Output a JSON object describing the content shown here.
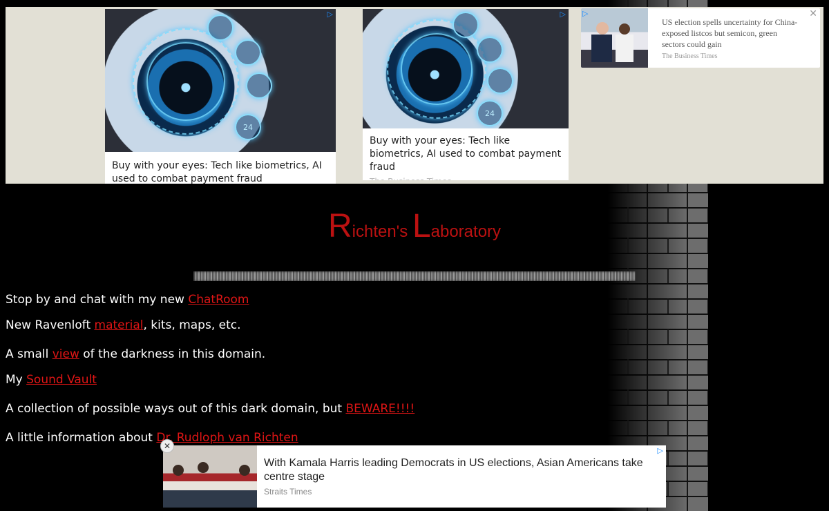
{
  "ads": {
    "card1": {
      "caption": "Buy with your eyes: Tech like biometrics, AI used to combat payment fraud"
    },
    "card2": {
      "caption": "Buy with your eyes: Tech like biometrics, AI used to combat payment fraud",
      "source": "The Business Times"
    },
    "card3": {
      "headline": "US election spells uncertainty for China-exposed listcos but semicon, green sectors could gain",
      "source": "The Business Times"
    },
    "bottom": {
      "headline": "With Kamala Harris leading Democrats in US elections, Asian Americans take centre stage",
      "source": "Straits Times",
      "close_label": "✕"
    },
    "eye_node_label": "24"
  },
  "page": {
    "title_first_initial": "R",
    "title_first_rest": "ichten's ",
    "title_second_initial": "L",
    "title_second_rest": "aboratory"
  },
  "links": [
    {
      "prefix": "Stop by and chat with my new ",
      "link": "ChatRoom",
      "suffix": ""
    },
    {
      "prefix": "New Ravenloft ",
      "link": "material",
      "suffix": ", kits, maps, etc."
    },
    {
      "prefix": "A small ",
      "link": "view",
      "suffix": " of the darkness in this domain."
    },
    {
      "prefix": "My ",
      "link": "Sound Vault",
      "suffix": ""
    },
    {
      "prefix": "A collection of possible ways out of this dark domain, but ",
      "link": "BEWARE!!!!",
      "suffix": ""
    },
    {
      "prefix": "A little information about ",
      "link": "Dr. Rudloph van Richten",
      "suffix": ""
    }
  ],
  "colors": {
    "title_red": "#bb1111",
    "link_red": "#e01515",
    "ad_bg": "#e2e0d5"
  },
  "icons": [
    "adchoices-icon",
    "close-icon",
    "brick-wall-background",
    "eye-biometrics-image"
  ]
}
